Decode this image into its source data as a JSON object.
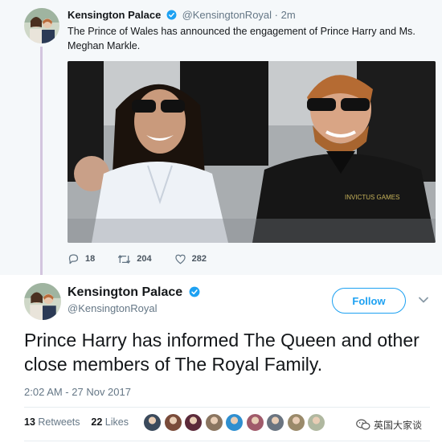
{
  "tweet1": {
    "name": "Kensington Palace",
    "handle": "@KensingtonRoyal",
    "dot": "·",
    "time": "2m",
    "text": "The Prince of Wales has announced the engagement of Prince Harry and Ms. Meghan Markle.",
    "photo_logo": "INVICTUS GAMES",
    "actions": {
      "replies": "18",
      "retweets": "204",
      "likes": "282"
    }
  },
  "tweet2": {
    "name": "Kensington Palace",
    "handle": "@KensingtonRoyal",
    "follow_label": "Follow",
    "text": "Prince Harry has informed The Queen and other close members of The Royal Family.",
    "timestamp": "2:02 AM - 27 Nov 2017",
    "retweets_count": "13",
    "retweets_label": "Retweets",
    "likes_count": "22",
    "likes_label": "Likes",
    "liker_colors": [
      "#3b4a5c",
      "#7a4b3a",
      "#5c2a3a",
      "#8a7560",
      "#2f8fd0",
      "#a05a6a",
      "#6a7480",
      "#9a8a6a",
      "#b0b8a0"
    ]
  },
  "watermark": {
    "text": "英国大家谈"
  },
  "colors": {
    "twitter_blue": "#1da1f2",
    "thread_line": "#d3c5de",
    "muted": "#657786"
  }
}
